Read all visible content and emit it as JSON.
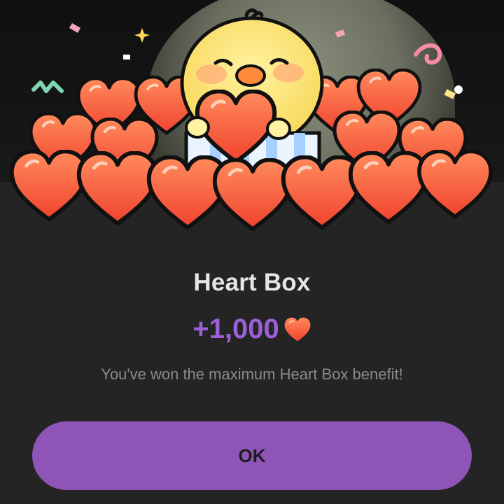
{
  "dialog": {
    "title": "Heart Box",
    "reward_amount": "+1,000",
    "reward_icon": "heart-icon",
    "message": "You've won the maximum Heart Box benefit!",
    "ok_label": "OK"
  },
  "colors": {
    "accent": "#8e54b6",
    "reward_text": "#9b5fd8",
    "heart": "#f45a3c",
    "background": "#242424"
  }
}
